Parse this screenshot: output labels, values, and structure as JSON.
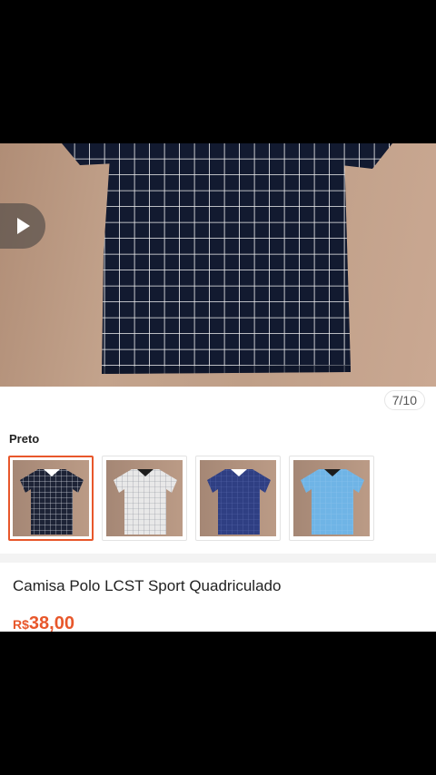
{
  "gallery": {
    "counter": "7/10"
  },
  "variant": {
    "label": "Preto",
    "options": [
      {
        "name": "black-grid",
        "color": "#1d2336",
        "line": "#ffffff",
        "collar": "#ffffff"
      },
      {
        "name": "white-grid",
        "color": "#e8e8e8",
        "line": "#7b7f8b",
        "collar": "#1c1c1c"
      },
      {
        "name": "navy",
        "color": "#2f3f83",
        "line": "#5a6bb0",
        "collar": "#ffffff"
      },
      {
        "name": "light-blue",
        "color": "#6fb4e6",
        "line": "#90c6ee",
        "collar": "#1c1c1c"
      }
    ],
    "selected_index": 0
  },
  "product": {
    "title": "Camisa Polo LCST Sport Quadriculado",
    "currency": "R$",
    "price": "38,00"
  },
  "colors": {
    "accent": "#e8572b",
    "shirt_black": "#121a30",
    "grid_line": "#ffffff"
  }
}
